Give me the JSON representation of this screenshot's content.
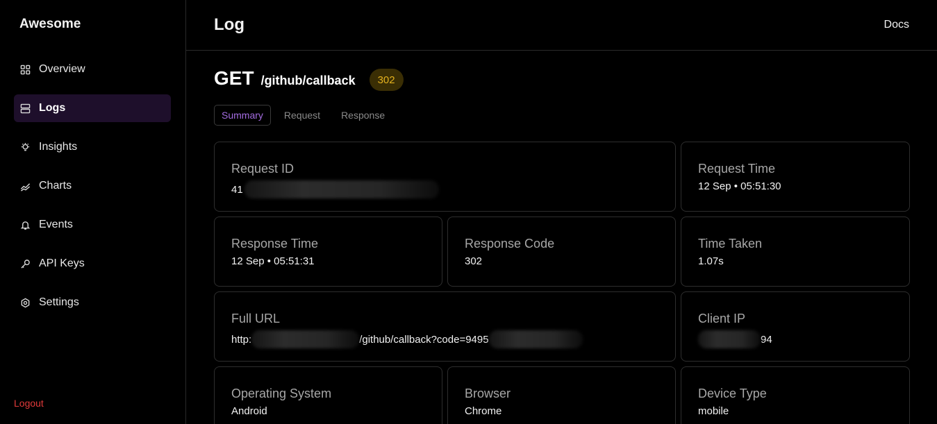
{
  "sidebar": {
    "brand": "Awesome",
    "items": [
      {
        "label": "Overview",
        "icon": "grid-icon"
      },
      {
        "label": "Logs",
        "icon": "server-icon"
      },
      {
        "label": "Insights",
        "icon": "lightbulb-icon"
      },
      {
        "label": "Charts",
        "icon": "trend-icon"
      },
      {
        "label": "Events",
        "icon": "bell-icon"
      },
      {
        "label": "API Keys",
        "icon": "key-icon"
      },
      {
        "label": "Settings",
        "icon": "gear-icon"
      }
    ],
    "logout": "Logout"
  },
  "header": {
    "title": "Log",
    "docs": "Docs"
  },
  "request": {
    "method": "GET",
    "path": "/github/callback",
    "status": "302"
  },
  "tabs": [
    "Summary",
    "Request",
    "Response"
  ],
  "cards": {
    "request_id": {
      "label": "Request ID",
      "value": "41"
    },
    "request_time": {
      "label": "Request Time",
      "value": "12 Sep • 05:51:30"
    },
    "response_time": {
      "label": "Response Time",
      "value": "12 Sep • 05:51:31"
    },
    "response_code": {
      "label": "Response Code",
      "value": "302"
    },
    "time_taken": {
      "label": "Time Taken",
      "value": "1.07s"
    },
    "full_url": {
      "label": "Full URL",
      "value_start": "http:",
      "value_mid": "/github/callback?code=9495"
    },
    "client_ip": {
      "label": "Client IP",
      "value_end": "94"
    },
    "os": {
      "label": "Operating System",
      "value": "Android"
    },
    "browser": {
      "label": "Browser",
      "value": "Chrome"
    },
    "device": {
      "label": "Device Type",
      "value": "mobile"
    }
  },
  "colors": {
    "accent": "#a36ce0",
    "active_bg": "#1e0f2b",
    "logout": "#e23a3a",
    "status_bg": "#3a2e04",
    "status_fg": "#e3b11f"
  }
}
